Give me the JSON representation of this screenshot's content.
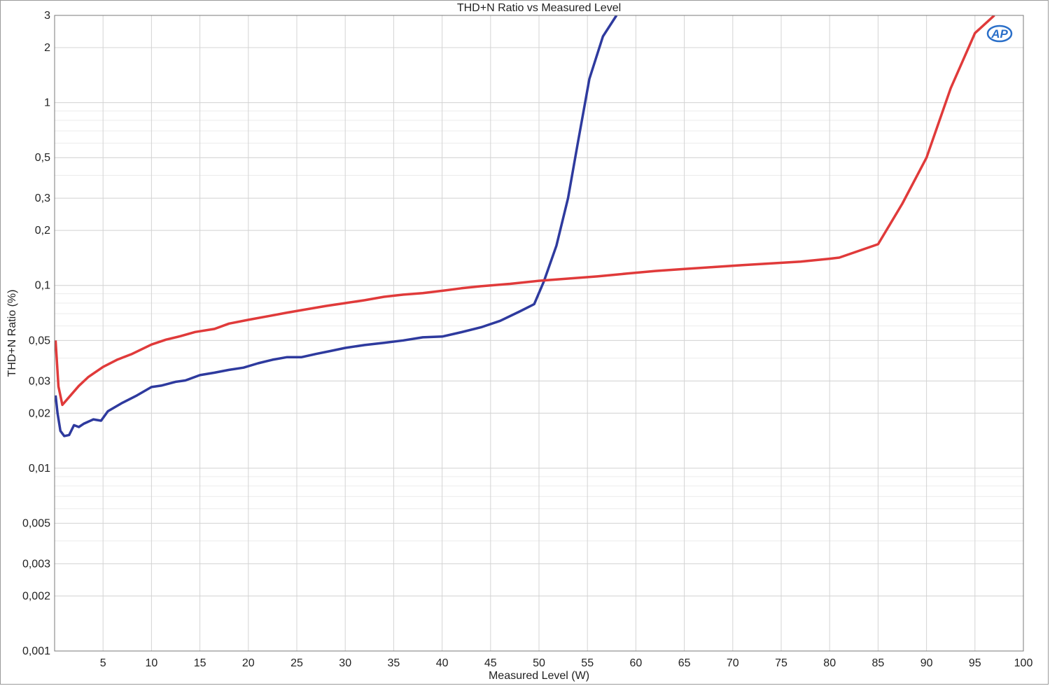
{
  "chart_data": {
    "type": "line",
    "title": "THD+N Ratio vs Measured Level",
    "xlabel": "Measured Level (W)",
    "ylabel": "THD+N Ratio (%)",
    "xlim": [
      0,
      100
    ],
    "ylim": [
      0.001,
      3
    ],
    "yscale": "log",
    "grid": true,
    "x_ticks": [
      5,
      10,
      15,
      20,
      25,
      30,
      35,
      40,
      45,
      50,
      55,
      60,
      65,
      70,
      75,
      80,
      85,
      90,
      95,
      100
    ],
    "x_tick_labels": [
      "5",
      "10",
      "15",
      "20",
      "25",
      "30",
      "35",
      "40",
      "45",
      "50",
      "55",
      "60",
      "65",
      "70",
      "75",
      "80",
      "85",
      "90",
      "95",
      "100"
    ],
    "y_ticks": [
      0.001,
      0.002,
      0.003,
      0.005,
      0.01,
      0.02,
      0.03,
      0.05,
      0.1,
      0.2,
      0.3,
      0.5,
      1,
      2,
      3
    ],
    "y_tick_labels": [
      "0,001",
      "0,002",
      "0,003",
      "0,005",
      "0,01",
      "0,02",
      "0,03",
      "0,05",
      "0,1",
      "0,2",
      "0,3",
      "0,5",
      "1",
      "2",
      "3"
    ],
    "series": [
      {
        "color": "#2e3a9e",
        "x": [
          0.1,
          0.3,
          0.6,
          1.0,
          1.5,
          2.0,
          2.5,
          3.0,
          4.0,
          4.8,
          5.5,
          7.0,
          8.5,
          10.0,
          11.0,
          12.5,
          13.5,
          15.0,
          16.5,
          18.0,
          19.5,
          21.0,
          22.5,
          24.0,
          25.5,
          27.0,
          28.5,
          30.0,
          32.0,
          34.0,
          36.0,
          38.0,
          40.0,
          42.0,
          44.0,
          46.0,
          48.0,
          49.5,
          50.5,
          51.8,
          53.0,
          54.0,
          55.2,
          56.6,
          58.0
        ],
        "y": [
          0.025,
          0.02,
          0.016,
          0.015,
          0.0152,
          0.0172,
          0.0168,
          0.0175,
          0.0185,
          0.0182,
          0.0205,
          0.0228,
          0.025,
          0.0278,
          0.0283,
          0.0297,
          0.0302,
          0.0323,
          0.0333,
          0.0345,
          0.0355,
          0.0375,
          0.0392,
          0.0405,
          0.0405,
          0.0422,
          0.0438,
          0.0455,
          0.0472,
          0.0485,
          0.05,
          0.052,
          0.0525,
          0.0555,
          0.059,
          0.064,
          0.072,
          0.079,
          0.105,
          0.165,
          0.3,
          0.6,
          1.35,
          2.3,
          3.0
        ]
      },
      {
        "color": "#e03a3a",
        "x": [
          0.1,
          0.4,
          0.8,
          1.5,
          2.5,
          3.5,
          5.0,
          6.5,
          8.0,
          10.0,
          11.5,
          13.0,
          14.5,
          16.5,
          18.0,
          20.0,
          22.0,
          24.0,
          26.0,
          28.0,
          30.0,
          32.0,
          34.0,
          36.0,
          38.0,
          40.0,
          42.0,
          44.0,
          47.0,
          50.0,
          53.0,
          56.0,
          59.0,
          62.0,
          65.0,
          68.0,
          71.0,
          74.0,
          77.0,
          80.0,
          81.0,
          85.0,
          87.5,
          90.0,
          92.5,
          95.0,
          97.0
        ],
        "y": [
          0.05,
          0.028,
          0.0222,
          0.0245,
          0.0282,
          0.0316,
          0.0358,
          0.0393,
          0.0422,
          0.0475,
          0.0505,
          0.0528,
          0.0556,
          0.0578,
          0.0618,
          0.0648,
          0.0678,
          0.071,
          0.074,
          0.0772,
          0.08,
          0.083,
          0.0866,
          0.089,
          0.0908,
          0.0935,
          0.0965,
          0.099,
          0.102,
          0.106,
          0.109,
          0.112,
          0.116,
          0.12,
          0.123,
          0.126,
          0.129,
          0.132,
          0.135,
          0.14,
          0.142,
          0.168,
          0.28,
          0.5,
          1.2,
          2.4,
          3.0
        ]
      }
    ]
  },
  "logo": {
    "text": "AP",
    "color": "#2a6fc9"
  }
}
